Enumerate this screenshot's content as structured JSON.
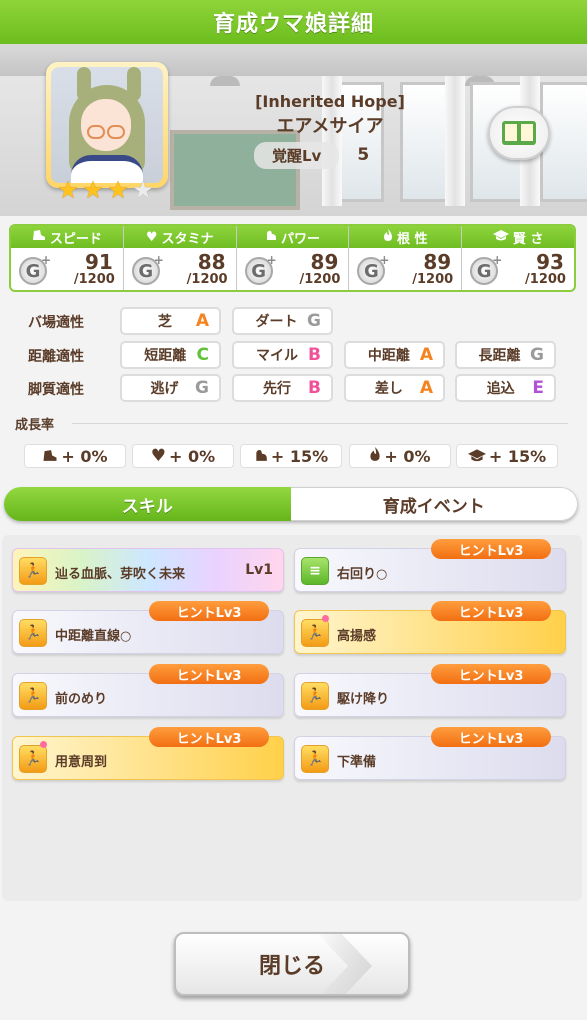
{
  "header": {
    "title": "育成ウマ娘詳細"
  },
  "profile": {
    "epithet": "[Inherited Hope]",
    "name": "エアメサイア",
    "awake_label": "覚醒Lv",
    "awake_value": "5",
    "stars_on": 3,
    "stars_total": 4
  },
  "stats": [
    {
      "label": "スピード",
      "icon": "shoe-icon",
      "glyph": "",
      "grade": "G",
      "value": "91",
      "max": "/1200"
    },
    {
      "label": "スタミナ",
      "icon": "heart-icon",
      "glyph": "♥",
      "grade": "G",
      "value": "88",
      "max": "/1200"
    },
    {
      "label": "パワー",
      "icon": "muscle-icon",
      "glyph": "",
      "grade": "G",
      "value": "89",
      "max": "/1200"
    },
    {
      "label": "根 性",
      "icon": "flame-icon",
      "glyph": "",
      "grade": "G",
      "value": "89",
      "max": "/1200"
    },
    {
      "label": "賢 さ",
      "icon": "mortarboard-icon",
      "glyph": "",
      "grade": "G",
      "value": "93",
      "max": "/1200"
    }
  ],
  "aptitudes": {
    "track": {
      "label": "バ場適性",
      "items": [
        {
          "name": "芝",
          "grade": "A"
        },
        {
          "name": "ダート",
          "grade": "G"
        }
      ]
    },
    "distance": {
      "label": "距離適性",
      "items": [
        {
          "name": "短距離",
          "grade": "C"
        },
        {
          "name": "マイル",
          "grade": "B"
        },
        {
          "name": "中距離",
          "grade": "A"
        },
        {
          "name": "長距離",
          "grade": "G"
        }
      ]
    },
    "style": {
      "label": "脚質適性",
      "items": [
        {
          "name": "逃げ",
          "grade": "G"
        },
        {
          "name": "先行",
          "grade": "B"
        },
        {
          "name": "差し",
          "grade": "A"
        },
        {
          "name": "追込",
          "grade": "E"
        }
      ]
    }
  },
  "grade_colors": {
    "A": "#f5831f",
    "B": "#f0529a",
    "C": "#5fc23a",
    "E": "#b053d6",
    "G": "#9a9a9a"
  },
  "growth": {
    "title": "成長率",
    "items": [
      {
        "icon": "shoe-icon",
        "value": "+ 0%"
      },
      {
        "icon": "heart-icon",
        "value": "+ 0%"
      },
      {
        "icon": "muscle-icon",
        "value": "+ 15%"
      },
      {
        "icon": "flame-icon",
        "value": "+ 0%"
      },
      {
        "icon": "mortarboard-icon",
        "value": "+ 15%"
      }
    ]
  },
  "tabs": [
    {
      "label": "スキル",
      "active": true
    },
    {
      "label": "育成イベント",
      "active": false
    }
  ],
  "skills": [
    {
      "name": "辿る血脈、芽吹く未来",
      "lv": "Lv1",
      "hint": "",
      "style": "rainbow",
      "icon": "run-icon"
    },
    {
      "name": "右回り○",
      "lv": "",
      "hint": "ヒントLv3",
      "style": "normal",
      "icon": "track-icon"
    },
    {
      "name": "中距離直線○",
      "lv": "",
      "hint": "ヒントLv3",
      "style": "normal",
      "icon": "run-icon"
    },
    {
      "name": "高揚感",
      "lv": "",
      "hint": "ヒントLv3",
      "style": "gold",
      "icon": "run-icon"
    },
    {
      "name": "前のめり",
      "lv": "",
      "hint": "ヒントLv3",
      "style": "normal",
      "icon": "run-icon"
    },
    {
      "name": "駆け降り",
      "lv": "",
      "hint": "ヒントLv3",
      "style": "normal",
      "icon": "run-icon"
    },
    {
      "name": "用意周到",
      "lv": "",
      "hint": "ヒントLv3",
      "style": "gold",
      "icon": "run-icon"
    },
    {
      "name": "下準備",
      "lv": "",
      "hint": "ヒントLv3",
      "style": "normal",
      "icon": "run-icon"
    }
  ],
  "close_label": "閉じる"
}
